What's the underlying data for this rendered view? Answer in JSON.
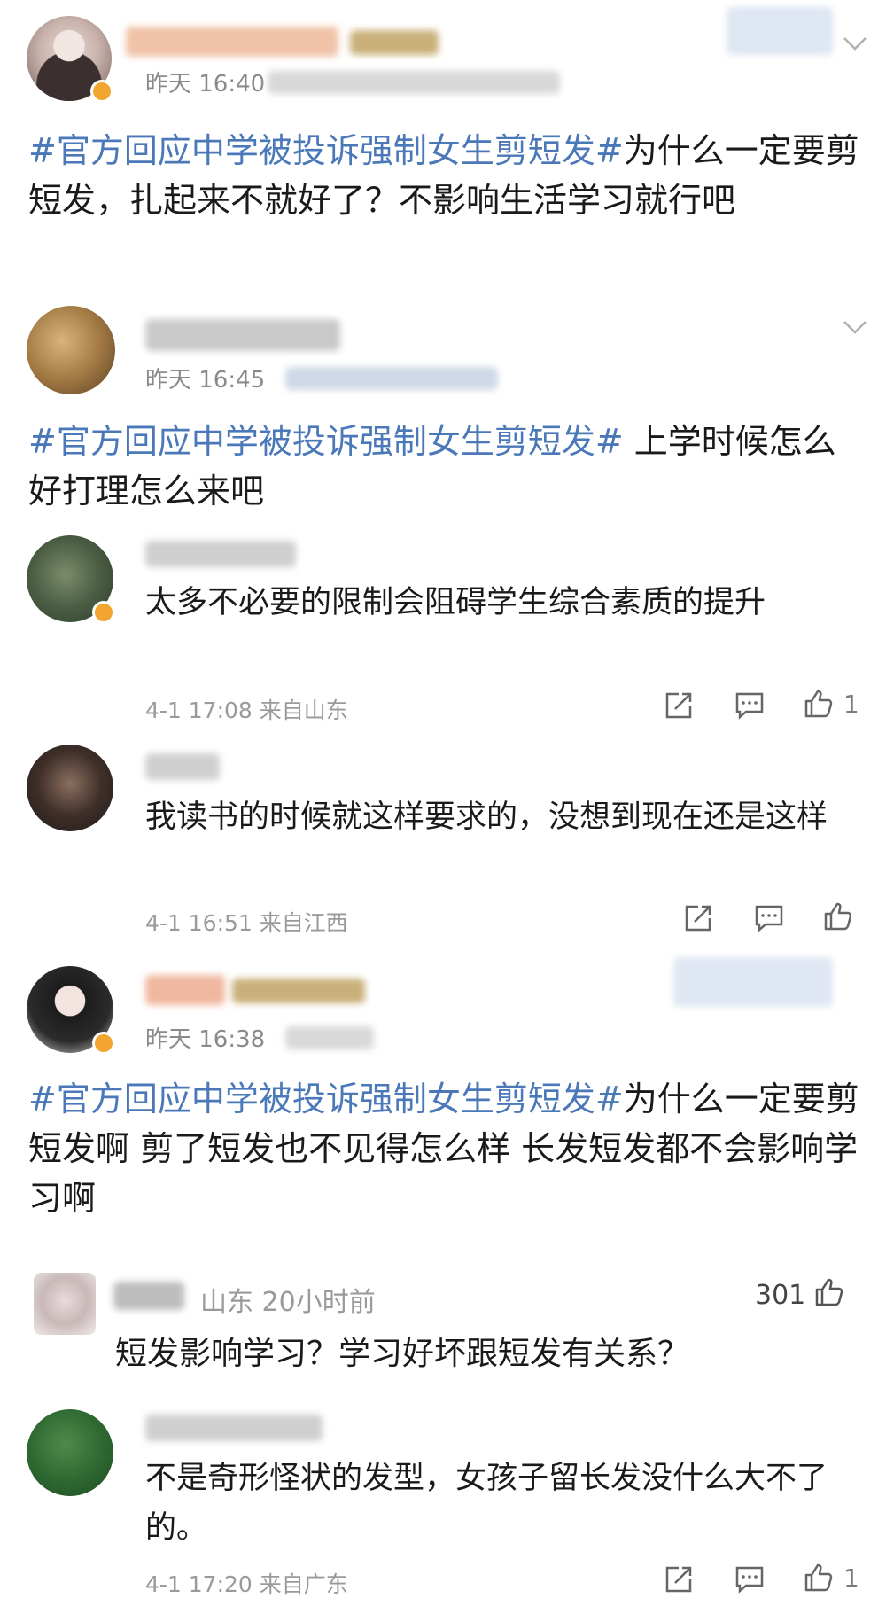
{
  "posts": [
    {
      "time": "昨天 16:40",
      "hashtag": "#官方回应中学被投诉强制女生剪短发#",
      "body": "为什么一定要剪短发，扎起来不就好了？不影响生活学习就行吧"
    },
    {
      "time": "昨天 16:45",
      "hashtag": "#官方回应中学被投诉强制女生剪短发#",
      "body": " 上学时候怎么好打理怎么来吧",
      "replies": [
        {
          "text": "太多不必要的限制会阻碍学生综合素质的提升",
          "time": "4-1 17:08 来自山东",
          "likes": "1"
        },
        {
          "text": "我读书的时候就这样要求的，没想到现在还是这样",
          "time": "4-1 16:51 来自江西",
          "likes": ""
        }
      ]
    },
    {
      "time": "昨天 16:38",
      "hashtag": "#官方回应中学被投诉强制女生剪短发#",
      "body": "为什么一定要剪短发啊 剪了短发也不见得怎么样 长发短发都不会影响学习啊",
      "reply_header": {
        "location_time": "山东 20小时前",
        "likes": "301"
      },
      "replies": [
        {
          "text": "短发影响学习？学习好坏跟短发有关系？"
        },
        {
          "text": "不是奇形怪状的发型，女孩子留长发没什么大不了的。",
          "time": "4-1 17:20 来自广东",
          "likes": "1"
        }
      ]
    }
  ],
  "colors": {
    "hashtag": "#4a78b8",
    "meta": "#8a8a8a",
    "badge": "#f3a531"
  },
  "icons": [
    "chevron-down-icon",
    "share-icon",
    "comment-icon",
    "like-icon",
    "verified-badge-icon"
  ]
}
